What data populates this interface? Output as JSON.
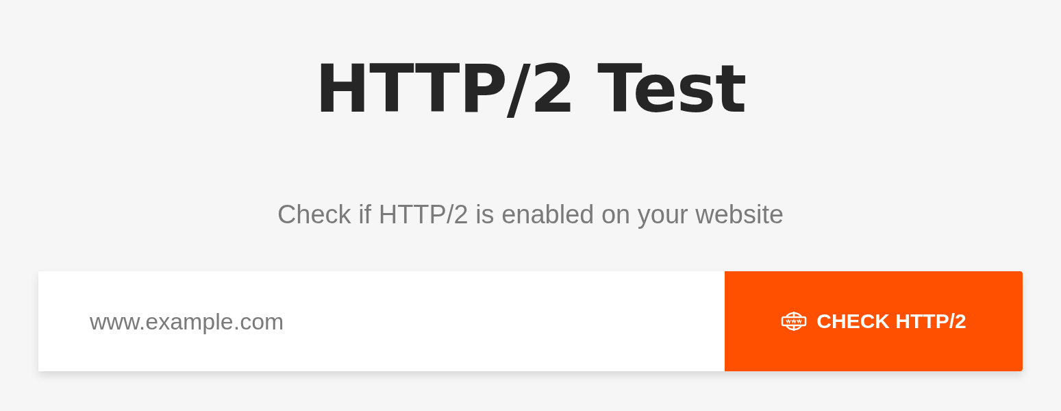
{
  "title": "HTTP/2 Test",
  "subtitle": "Check if HTTP/2 is enabled on your website",
  "form": {
    "placeholder": "www.example.com",
    "button": "CHECK HTTP/2"
  }
}
